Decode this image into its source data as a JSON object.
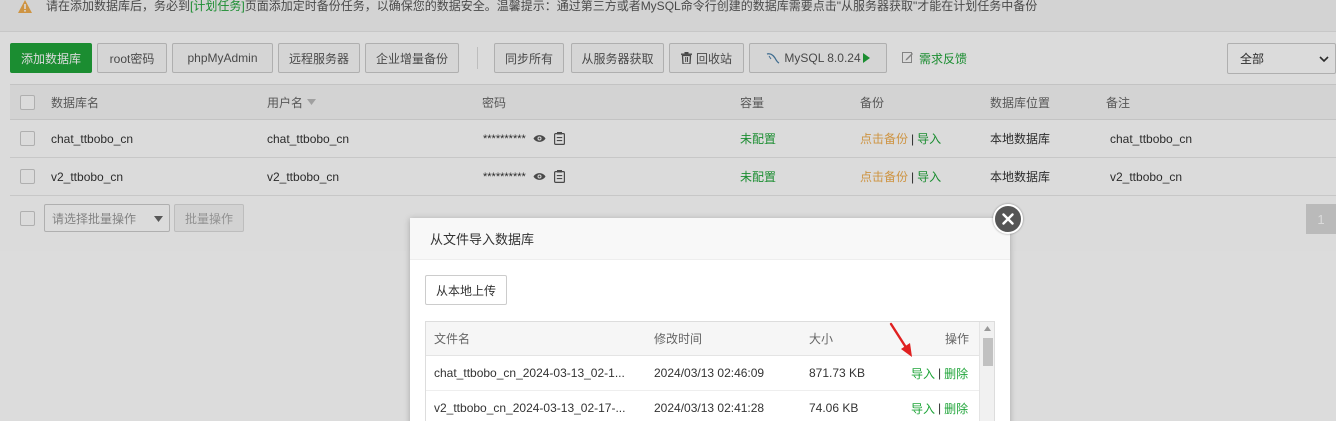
{
  "notice": {
    "pre": "请在添加数据库后，务必到",
    "link": "[计划任务]",
    "post": "页面添加定时备份任务，以确保您的数据安全。温馨提示：通过第三方或者MySQL命令行创建的数据库需要点击\"从服务器获取\"才能在计划任务中备份"
  },
  "toolbar": {
    "add_db": "添加数据库",
    "root_pwd": "root密码",
    "phpmyadmin": "phpMyAdmin",
    "remote": "远程服务器",
    "enterprise": "企业增量备份",
    "sync_all": "同步所有",
    "fetch_server": "从服务器获取",
    "recycle": "回收站",
    "mysql_version": "MySQL 8.0.24",
    "feedback": "需求反馈",
    "filter_value": "全部"
  },
  "table": {
    "headers": {
      "name": "数据库名",
      "user": "用户名",
      "password": "密码",
      "capacity": "容量",
      "backup": "备份",
      "location": "数据库位置",
      "note": "备注"
    },
    "rows": [
      {
        "name": "chat_ttbobo_cn",
        "user": "chat_ttbobo_cn",
        "password": "**********",
        "capacity": "未配置",
        "backup": "点击备份",
        "import": "导入",
        "location": "本地数据库",
        "note": "chat_ttbobo_cn"
      },
      {
        "name": "v2_ttbobo_cn",
        "user": "v2_ttbobo_cn",
        "password": "**********",
        "capacity": "未配置",
        "backup": "点击备份",
        "import": "导入",
        "location": "本地数据库",
        "note": "v2_ttbobo_cn"
      }
    ],
    "separator": "|"
  },
  "bottom": {
    "batch_placeholder": "请选择批量操作",
    "batch_button": "批量操作",
    "page": "1"
  },
  "modal": {
    "title": "从文件导入数据库",
    "upload": "从本地上传",
    "headers": {
      "file": "文件名",
      "mtime": "修改时间",
      "size": "大小",
      "ops": "操作"
    },
    "files": [
      {
        "file": "chat_ttbobo_cn_2024-03-13_02-1...",
        "mtime": "2024/03/13 02:46:09",
        "size": "871.73 KB",
        "import": "导入",
        "delete": "删除"
      },
      {
        "file": "v2_ttbobo_cn_2024-03-13_02-17-...",
        "mtime": "2024/03/13 02:41:28",
        "size": "74.06 KB",
        "import": "导入",
        "delete": "删除"
      }
    ],
    "separator": "|"
  },
  "colors": {
    "accent": "#20a53a",
    "warning": "#f0ad4e",
    "arrow": "#e02020"
  }
}
